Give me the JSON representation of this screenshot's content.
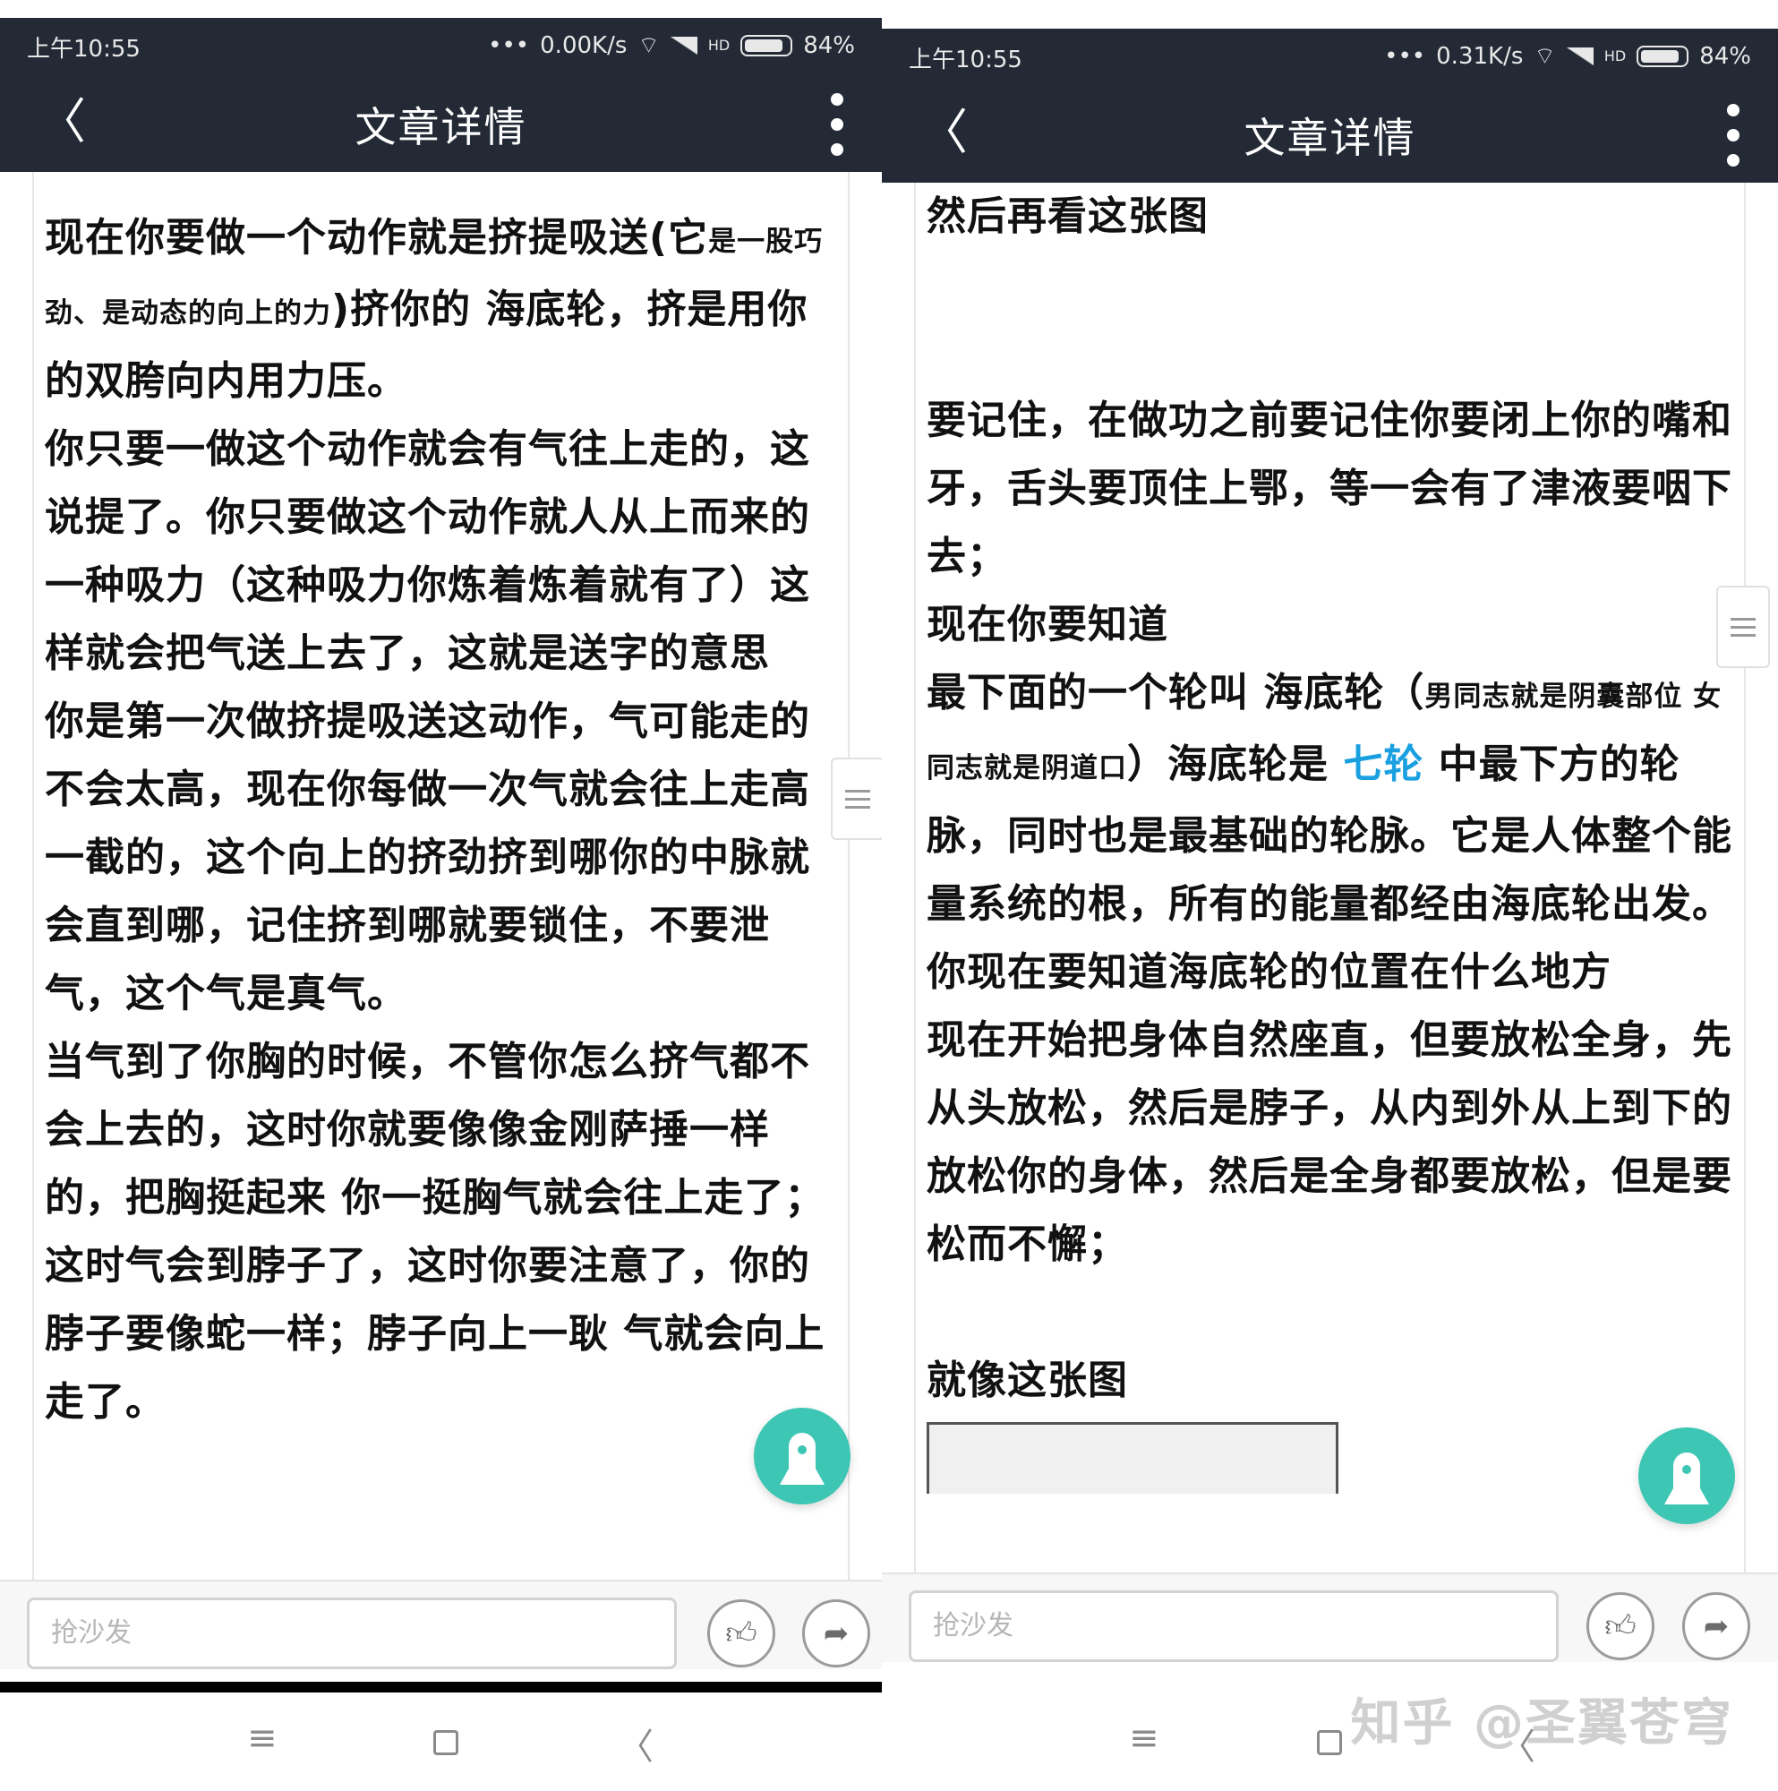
{
  "left": {
    "status": {
      "time": "上午10:55",
      "dots": "•••",
      "speed": "0.00K/s",
      "hd": "HD",
      "battery": "84%"
    },
    "nav": {
      "title": "文章详情",
      "back_glyph": "〈"
    },
    "paragraphs": [
      {
        "main": "现在你要做一个动作就是挤提吸送(它",
        "small": "是一股巧劲、是动态的向上的力",
        "rest": ")挤你的 海底轮，挤是用你的双胯向内用力压。"
      },
      {
        "text": "你只要一做这个动作就会有气往上走的，这说提了。你只要做这个动作就人从上而来的一种吸力（这种吸力你炼着炼着就有了）这样就会把气送上去了，这就是送字的意思"
      },
      {
        "text": "你是第一次做挤提吸送这动作，气可能走的不会太高，现在你每做一次气就会往上走高一截的，这个向上的挤劲挤到哪你的中脉就会直到哪，记住挤到哪就要锁住，不要泄气，这个气是真气。"
      },
      {
        "text": "当气到了你胸的时候，不管你怎么挤气都不会上去的，这时你就要像像金刚萨捶一样的，把胸挺起来 你一挺胸气就会往上走了；"
      },
      {
        "text": "这时气会到脖子了，这时你要注意了，你的脖子要像蛇一样；脖子向上一耿 气就会向上走了。"
      }
    ],
    "comment": {
      "placeholder": "抢沙发"
    }
  },
  "right": {
    "status": {
      "time": "上午10:55",
      "dots": "•••",
      "speed": "0.31K/s",
      "hd": "HD",
      "battery": "84%"
    },
    "nav": {
      "title": "文章详情",
      "back_glyph": "〈"
    },
    "intro": "然后再看这张图",
    "p1": "要记住，在做功之前要记住你要闭上你的嘴和牙，舌头要顶住上鄂，等一会有了津液要咽下去；",
    "p2": "现在你要知道",
    "p3a": "最下面的一个轮叫 海底轮（",
    "p3small": "男同志就是阴囊部位 女同志就是阴道口",
    "p3b": "）海底轮是 ",
    "p3blue": "七轮",
    "p3c": " 中最下方的轮脉，同时也是最基础的轮脉。它是人体整个能量系统的根，所有的能量都经由海底轮出发。你现在要知道海底轮的位置在什么地方",
    "p4": "现在开始把身体自然座直，但要放松全身，先从头放松，然后是脖子，从内到外从上到下的放松你的身体，然后是全身都要放松，但是要松而不懈；",
    "p5": "就像这张图",
    "comment": {
      "placeholder": "抢沙发"
    }
  },
  "sysnav": {
    "menu_glyph": "≡",
    "back_glyph": "〈"
  },
  "watermark": "知乎 @圣翼苍穹",
  "colors": {
    "topbar": "#232a36",
    "fab": "#3dc6b3",
    "link": "#1aa0e0"
  }
}
